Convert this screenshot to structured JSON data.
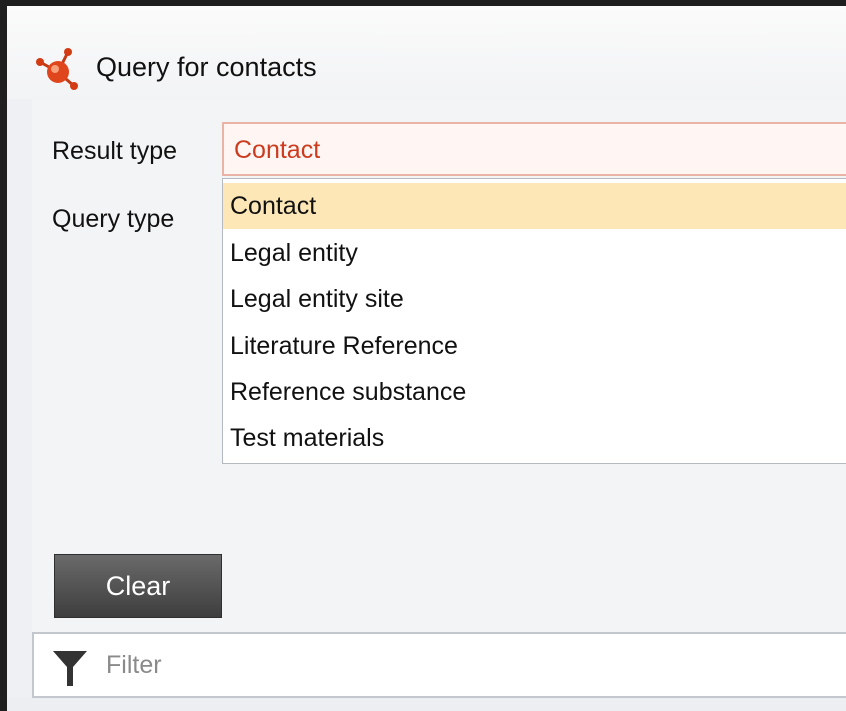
{
  "window": {
    "title": "Query for contacts",
    "icon": "molecule-icon"
  },
  "form": {
    "result_type_label": "Result type",
    "result_type_value": "Contact",
    "query_type_label": "Query type"
  },
  "dropdown": {
    "options": [
      {
        "label": "Contact",
        "selected": true
      },
      {
        "label": "Legal entity",
        "selected": false
      },
      {
        "label": "Legal entity site",
        "selected": false
      },
      {
        "label": "Literature Reference",
        "selected": false
      },
      {
        "label": "Reference substance",
        "selected": false
      },
      {
        "label": "Test materials",
        "selected": false
      }
    ]
  },
  "buttons": {
    "clear_label": "Clear"
  },
  "filter": {
    "placeholder": "Filter",
    "icon": "funnel-icon"
  },
  "colors": {
    "accent_red": "#cc3b1e",
    "selection_highlight": "#fde7b6",
    "button_dark": "#4a4a4a"
  }
}
